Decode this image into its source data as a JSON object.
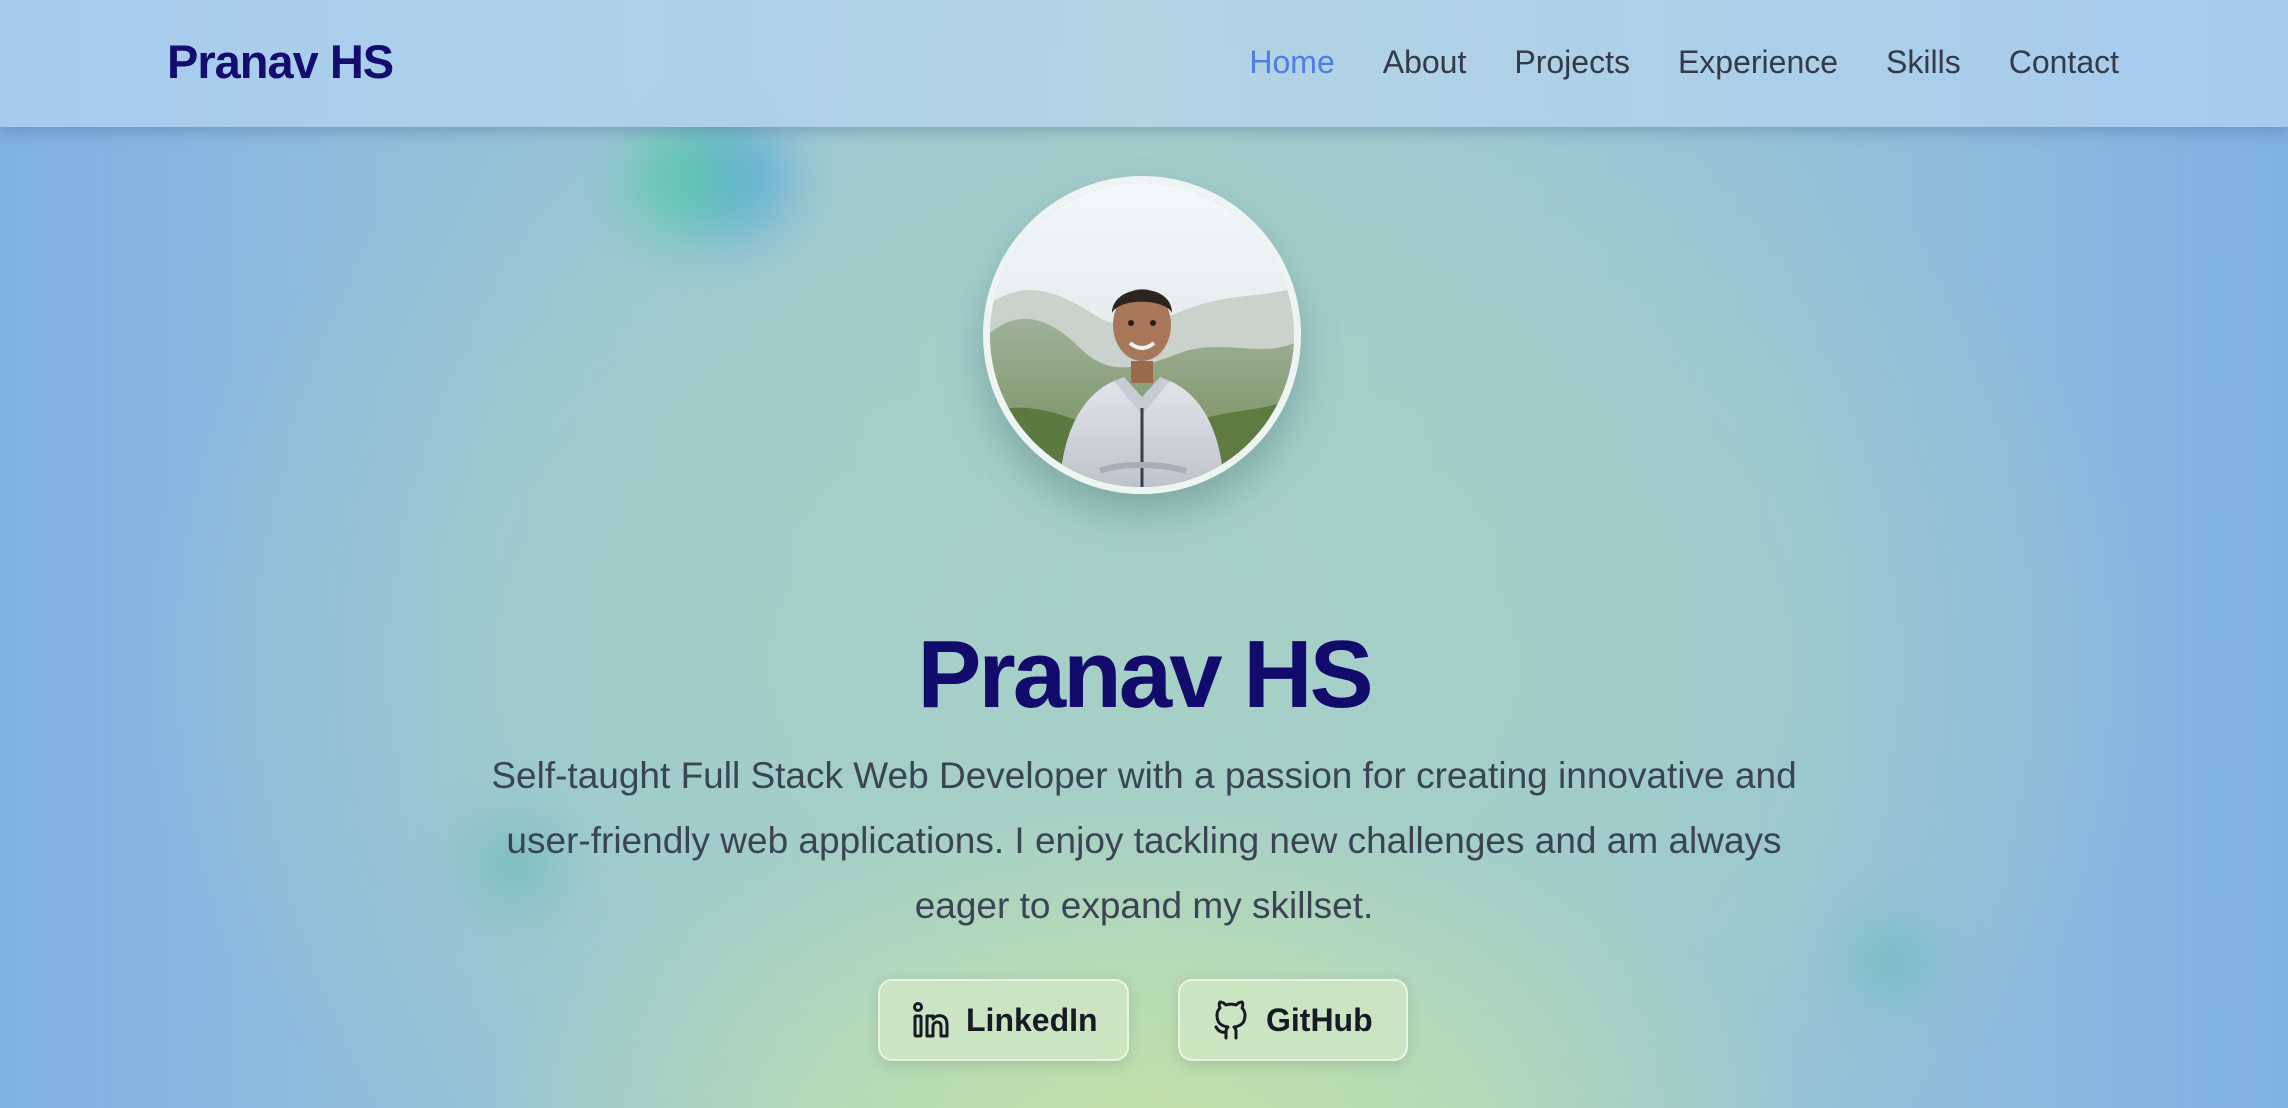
{
  "navbar": {
    "brand": "Pranav HS",
    "links": [
      {
        "label": "Home",
        "active": true
      },
      {
        "label": "About",
        "active": false
      },
      {
        "label": "Projects",
        "active": false
      },
      {
        "label": "Experience",
        "active": false
      },
      {
        "label": "Skills",
        "active": false
      },
      {
        "label": "Contact",
        "active": false
      }
    ]
  },
  "hero": {
    "name": "Pranav HS",
    "bio": "Self-taught Full Stack Web Developer with a passion for creating innovative and user-friendly web applications. I enjoy tackling new challenges and am always eager to expand my skillset.",
    "social": [
      {
        "label": "LinkedIn",
        "icon": "linkedin-icon"
      },
      {
        "label": "GitHub",
        "icon": "github-icon"
      }
    ]
  },
  "colors": {
    "brand": "#140c6e",
    "nav_active": "#4f7de6",
    "nav_text": "#333a48",
    "body_text": "#3a4454"
  }
}
